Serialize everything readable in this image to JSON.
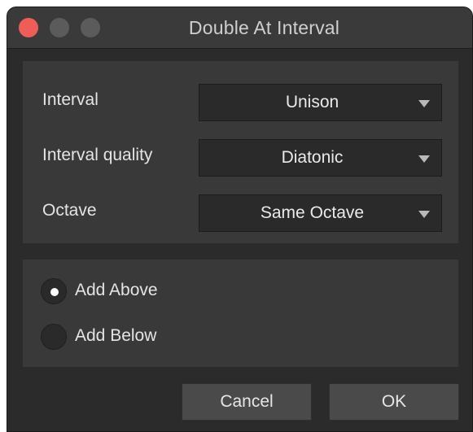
{
  "window": {
    "title": "Double At Interval"
  },
  "options": {
    "interval": {
      "label": "Interval",
      "value": "Unison"
    },
    "quality": {
      "label": "Interval quality",
      "value": "Diatonic"
    },
    "octave": {
      "label": "Octave",
      "value": "Same Octave"
    }
  },
  "placement": {
    "add_above": {
      "label": "Add Above",
      "selected": true
    },
    "add_below": {
      "label": "Add Below",
      "selected": false
    }
  },
  "buttons": {
    "cancel": "Cancel",
    "ok": "OK"
  },
  "colors": {
    "close": "#ee5e57",
    "inactive_traffic": "#5b5b5b",
    "background": "#2b2b2b",
    "panel": "#393939"
  }
}
